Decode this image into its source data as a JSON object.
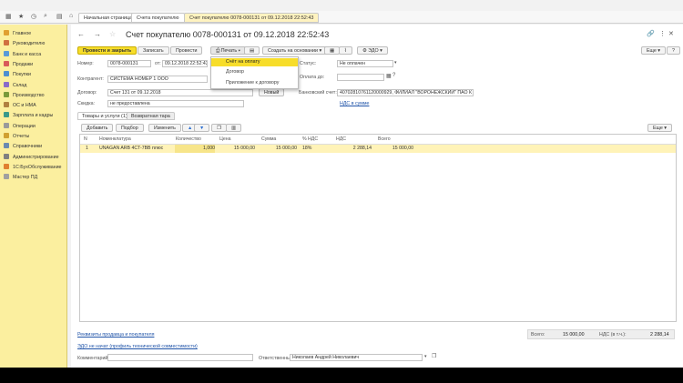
{
  "tabs": {
    "home": "Начальная страница",
    "invoices": "Счета покупателю",
    "current": "Счет покупателю 0078-000131 от 09.12.2018 22:52:43"
  },
  "sidebar": {
    "items": [
      {
        "label": "Главное",
        "color": "#e0a030"
      },
      {
        "label": "Руководителю",
        "color": "#d07040"
      },
      {
        "label": "Банк и касса",
        "color": "#5a9ad8"
      },
      {
        "label": "Продажи",
        "color": "#d85a5a"
      },
      {
        "label": "Покупки",
        "color": "#4d8fd0"
      },
      {
        "label": "Склад",
        "color": "#8a6bc8"
      },
      {
        "label": "Производство",
        "color": "#7a9a3a"
      },
      {
        "label": "ОС и НМА",
        "color": "#b08040"
      },
      {
        "label": "Зарплата и кадры",
        "color": "#3a9a8a"
      },
      {
        "label": "Операции",
        "color": "#9a9a9a"
      },
      {
        "label": "Отчеты",
        "color": "#d0a030"
      },
      {
        "label": "Справочники",
        "color": "#6a8ab0"
      },
      {
        "label": "Администрирование",
        "color": "#808080"
      },
      {
        "label": "1С:БухОбслуживание",
        "color": "#e08030"
      },
      {
        "label": "Мастер ПД",
        "color": "#a0a0a0"
      }
    ]
  },
  "header": {
    "title": "Счет покупателю 0078-000131 от 09.12.2018 22:52:43"
  },
  "toolbar": {
    "post_close": "Провести и закрыть",
    "save": "Записать",
    "post": "Провести",
    "print": "Печать",
    "create_based": "Создать на основании",
    "edo": "ЭДО",
    "more": "Еще"
  },
  "print_menu": {
    "items": [
      "Счёт на оплату",
      "Договор",
      "Приложение к договору"
    ]
  },
  "form": {
    "number_label": "Номер:",
    "number": "0078-000131",
    "from_label": "от:",
    "date": "09.12.2018 22:52:43",
    "status_label": "Статус:",
    "status": "Не оплачен",
    "counterparty_label": "Контрагент:",
    "counterparty": "СИСТЕМА НОМЕР 1 ООО",
    "payment_due_label": "Оплата до:",
    "contract_label": "Договор:",
    "contract": "Счет 131 от 09.12.2018",
    "new_button": "Новый",
    "bank_label": "Банковский счет:",
    "bank": "40702810761120000929, ФИЛИАЛ \"ВОРОНЕЖСКИЙ\" ПАО К",
    "discount_label": "Скидка:",
    "discount": "не предоставлена",
    "vat_link": "НДС в сумме"
  },
  "subtabs": {
    "goods": "Товары и услуги (1)",
    "returnable": "Возвратная тара"
  },
  "table_toolbar": {
    "add": "Добавить",
    "select": "Подбор",
    "change": "Изменить",
    "more": "Еще"
  },
  "table": {
    "headers": [
      "N",
      "Номенклатура",
      "Количество",
      "Цена",
      "Сумма",
      "% НДС",
      "НДС",
      "Всего"
    ],
    "rows": [
      [
        "1",
        "UNAGAN ARB 4CT-7ВВ плюс",
        "1,000",
        "15 000,00",
        "15 000,00",
        "18%",
        "2 288,14",
        "15 000,00"
      ]
    ]
  },
  "footer": {
    "requisites_link": "Реквизиты продавца и покупателя",
    "edo_link": "ЭДО не начат (профиль технической совместимости)",
    "comment_label": "Комментарий:",
    "responsible_label": "Ответственный:",
    "responsible": "Николаев Андрей Николаевич",
    "total_label": "Всего:",
    "total": "15 000,00",
    "vat_label": "НДС (в т.ч.):",
    "vat_total": "2 288,14"
  }
}
